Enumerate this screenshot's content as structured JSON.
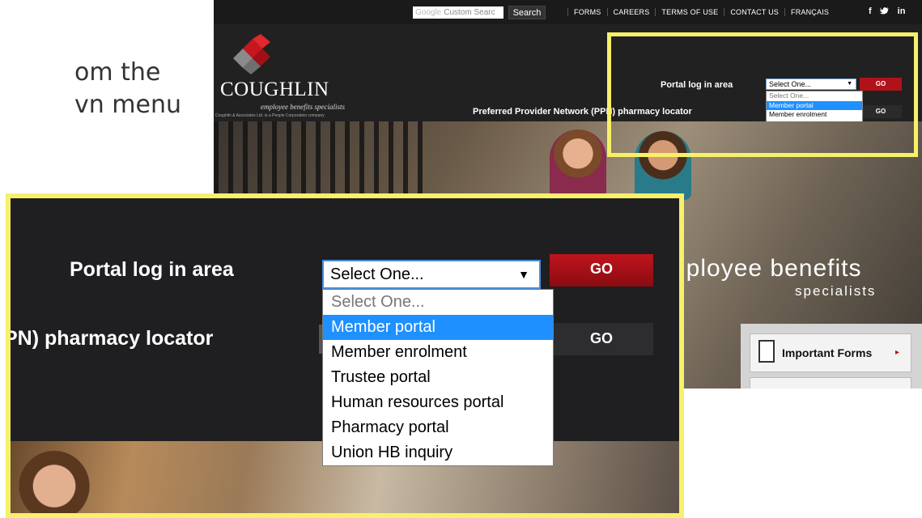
{
  "slide": {
    "line1": "om the",
    "line2": "vn menu"
  },
  "topbar": {
    "search_brand": "Google",
    "search_placeholder": "Custom Searc",
    "search_button": "Search",
    "nav": [
      "FORMS",
      "CAREERS",
      "TERMS OF USE",
      "CONTACT US",
      "FRANÇAIS"
    ],
    "social": [
      "f",
      "🐦",
      "in"
    ]
  },
  "logo": {
    "name": "COUGHLIN",
    "tagline": "employee benefits specialists",
    "subline": "Coughlin & Associates Ltd. is a People Corporation company"
  },
  "portal": {
    "label": "Portal log in area",
    "selected": "Select One...",
    "go": "GO",
    "options": [
      "Select One...",
      "Member portal",
      "Member enrolment",
      "Trustee portal",
      "Human resources portal",
      "Pharmacy portal",
      "Union HB inquiry"
    ],
    "highlighted_option": "Member portal"
  },
  "ppn": {
    "label_full": "Preferred Provider Network (PPN) pharmacy locator",
    "label_cropped": "PN) pharmacy locator",
    "go": "GO"
  },
  "hero": {
    "headline_cropped": "nployee benefits",
    "sub": "specialists"
  },
  "sidebar": {
    "forms_label": "Important Forms",
    "forms_arrow": "▸"
  },
  "colors": {
    "highlight_border": "#f7f06a",
    "go_red": "#b01219",
    "selected_option_bg": "#1e90ff",
    "header_bg": "#212121"
  }
}
